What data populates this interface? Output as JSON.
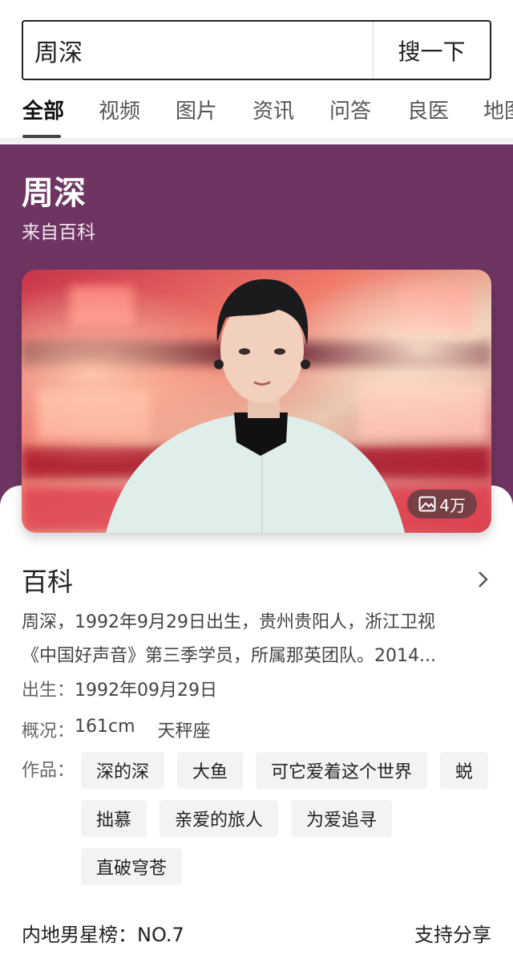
{
  "search": {
    "query": "周深",
    "button_label": "搜一下"
  },
  "tabs": [
    {
      "label": "全部",
      "active": true
    },
    {
      "label": "视频"
    },
    {
      "label": "图片"
    },
    {
      "label": "资讯"
    },
    {
      "label": "问答"
    },
    {
      "label": "良医"
    },
    {
      "label": "地图"
    }
  ],
  "hero": {
    "title": "周深",
    "source": "来自百科",
    "background_color": "#6e3562"
  },
  "photo": {
    "count_label": "4万",
    "icon": "image-icon"
  },
  "baike": {
    "title": "百科",
    "arrow_icon": "chevron-right-icon",
    "description_line1": "周深，1992年9月29日出生，贵州贵阳人，浙江卫视",
    "description_line2": "《中国好声音》第三季学员，所属那英团队。2014...",
    "birth_label": "出生：",
    "birth_value": "1992年09月29日",
    "overview_label": "概况：",
    "height": "161cm",
    "zodiac": "天秤座",
    "works_label": "作品：",
    "works": [
      "深的深",
      "大鱼",
      "可它爱着这个世界",
      "蜕",
      "拙慕",
      "亲爱的旅人",
      "为爱追寻",
      "直破穹苍"
    ]
  },
  "footer": {
    "ranking": "内地男星榜：NO.7",
    "share": "支持分享"
  }
}
